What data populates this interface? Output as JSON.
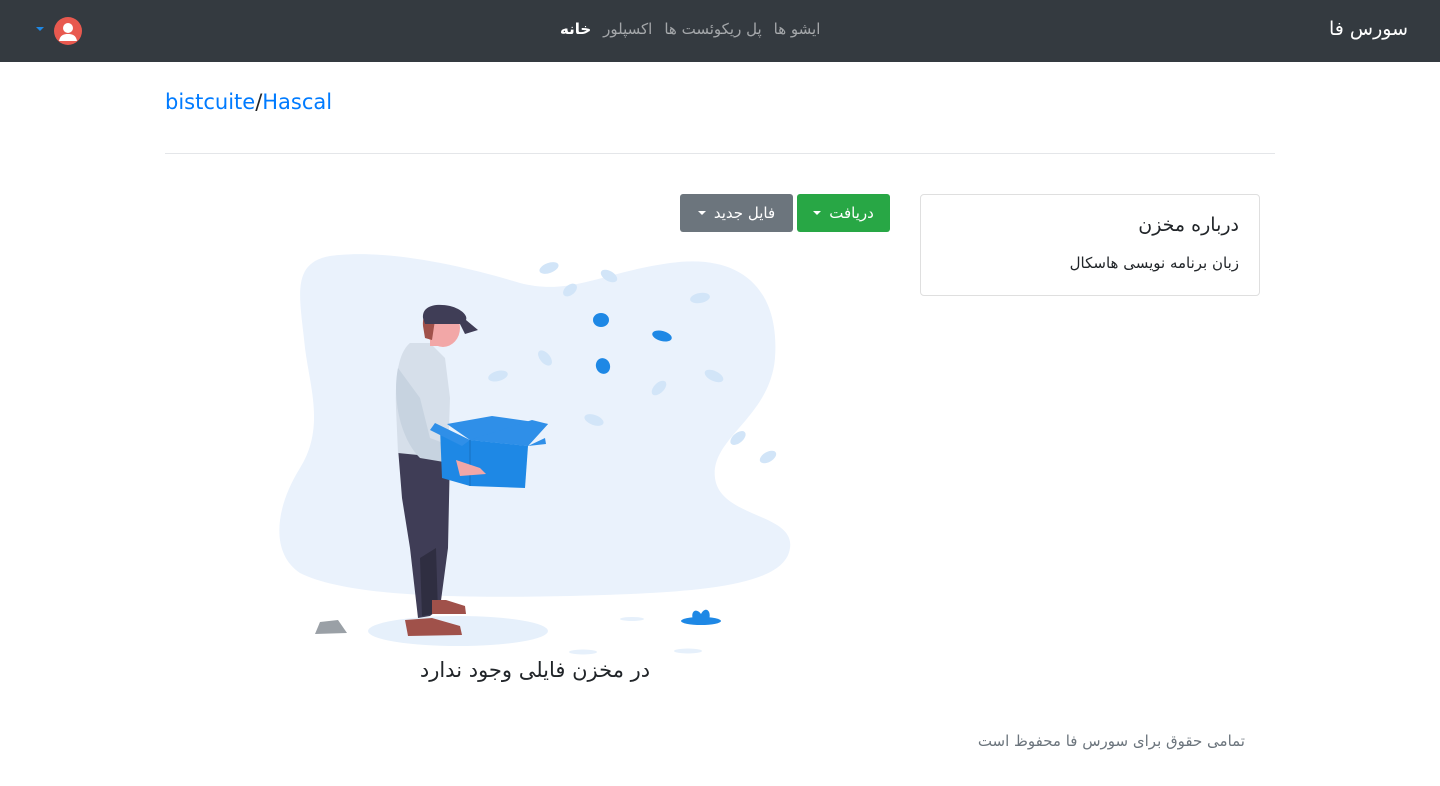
{
  "navbar": {
    "brand": "سورس فا",
    "links": [
      {
        "label": "خانه",
        "active": true
      },
      {
        "label": "اکسپلور",
        "active": false
      },
      {
        "label": "پل ریکوئست ها",
        "active": false
      },
      {
        "label": "ایشو ها",
        "active": false
      }
    ],
    "user_menu": {
      "avatar_icon": "user-avatar-icon",
      "caret_icon": "caret-down-icon"
    }
  },
  "breadcrumb": {
    "owner": "bistcuite",
    "separator": "/",
    "repo": "Hascal"
  },
  "actions": {
    "download_label": "دریافت",
    "new_file_label": "فایل جدید"
  },
  "about": {
    "title": "درباره مخزن",
    "description": "زبان برنامه نویسی هاسکال"
  },
  "empty_state": {
    "illustration_icon": "empty-box-illustration",
    "message": "در مخزن فایلی وجود ندارد"
  },
  "footer": {
    "text": "تمامی حقوق برای سورس فا محفوظ است"
  },
  "colors": {
    "navbar_bg": "#343a40",
    "link": "#007bff",
    "download_button": "#28a745",
    "new_file_button": "#6c757d",
    "avatar": "#e8594f",
    "illustration_accent": "#1e88e5"
  }
}
